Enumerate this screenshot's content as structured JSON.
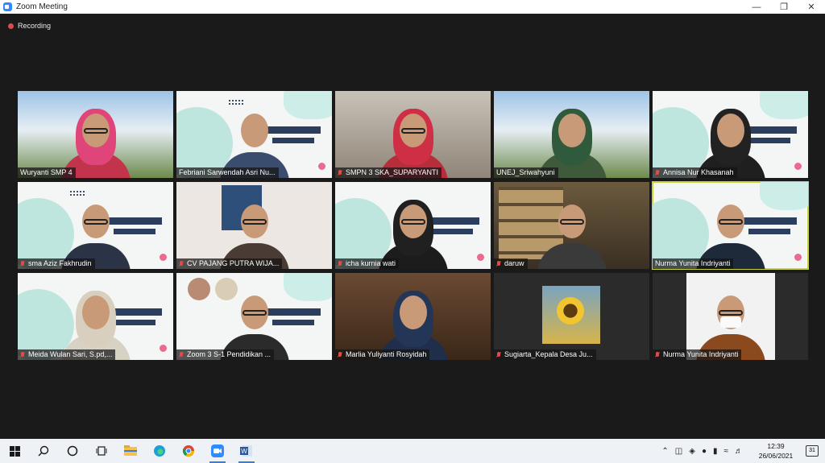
{
  "window": {
    "title": "Zoom Meeting"
  },
  "recording": {
    "label": "Recording",
    "color": "#e04a4a"
  },
  "participants": [
    {
      "name": "Wuryanti SMP 4",
      "muted": false
    },
    {
      "name": "Febriani Sarwendah Asri Nu...",
      "muted": false
    },
    {
      "name": "SMPN 3 SKA_SUPARYANTI",
      "muted": true
    },
    {
      "name": "UNEJ_Sriwahyuni",
      "muted": false
    },
    {
      "name": "Annisa Nur Khasanah",
      "muted": true
    },
    {
      "name": "sma Aziz Fakhrudin",
      "muted": true
    },
    {
      "name": "CV PAJANG PUTRA WIJA...",
      "muted": true
    },
    {
      "name": "icha kurnia wati",
      "muted": true
    },
    {
      "name": "daruw",
      "muted": true
    },
    {
      "name": "Nurma Yunita Indriyanti",
      "muted": false,
      "active_speaker": true
    },
    {
      "name": "Meida Wulan Sari, S.pd,...",
      "muted": true
    },
    {
      "name": "Zoom 3 S-1 Pendidikan ...",
      "muted": true
    },
    {
      "name": "Marlia Yuliyanti Rosyidah",
      "muted": true
    },
    {
      "name": "Sugiarta_Kepala Desa Ju...",
      "muted": true
    },
    {
      "name": "Nurma Yunita Indriyanti",
      "muted": true
    }
  ],
  "taskbar": {
    "time": "12:39",
    "date": "26/06/2021",
    "notifications": "31",
    "apps": [
      "windows-icon",
      "search-icon",
      "cortana-icon",
      "task-view-icon",
      "file-explorer-icon",
      "edge-icon",
      "chrome-icon",
      "zoom-icon",
      "word-icon"
    ]
  },
  "colors": {
    "active_speaker_outline": "#c9d23a",
    "background": "#1a1a1a"
  }
}
